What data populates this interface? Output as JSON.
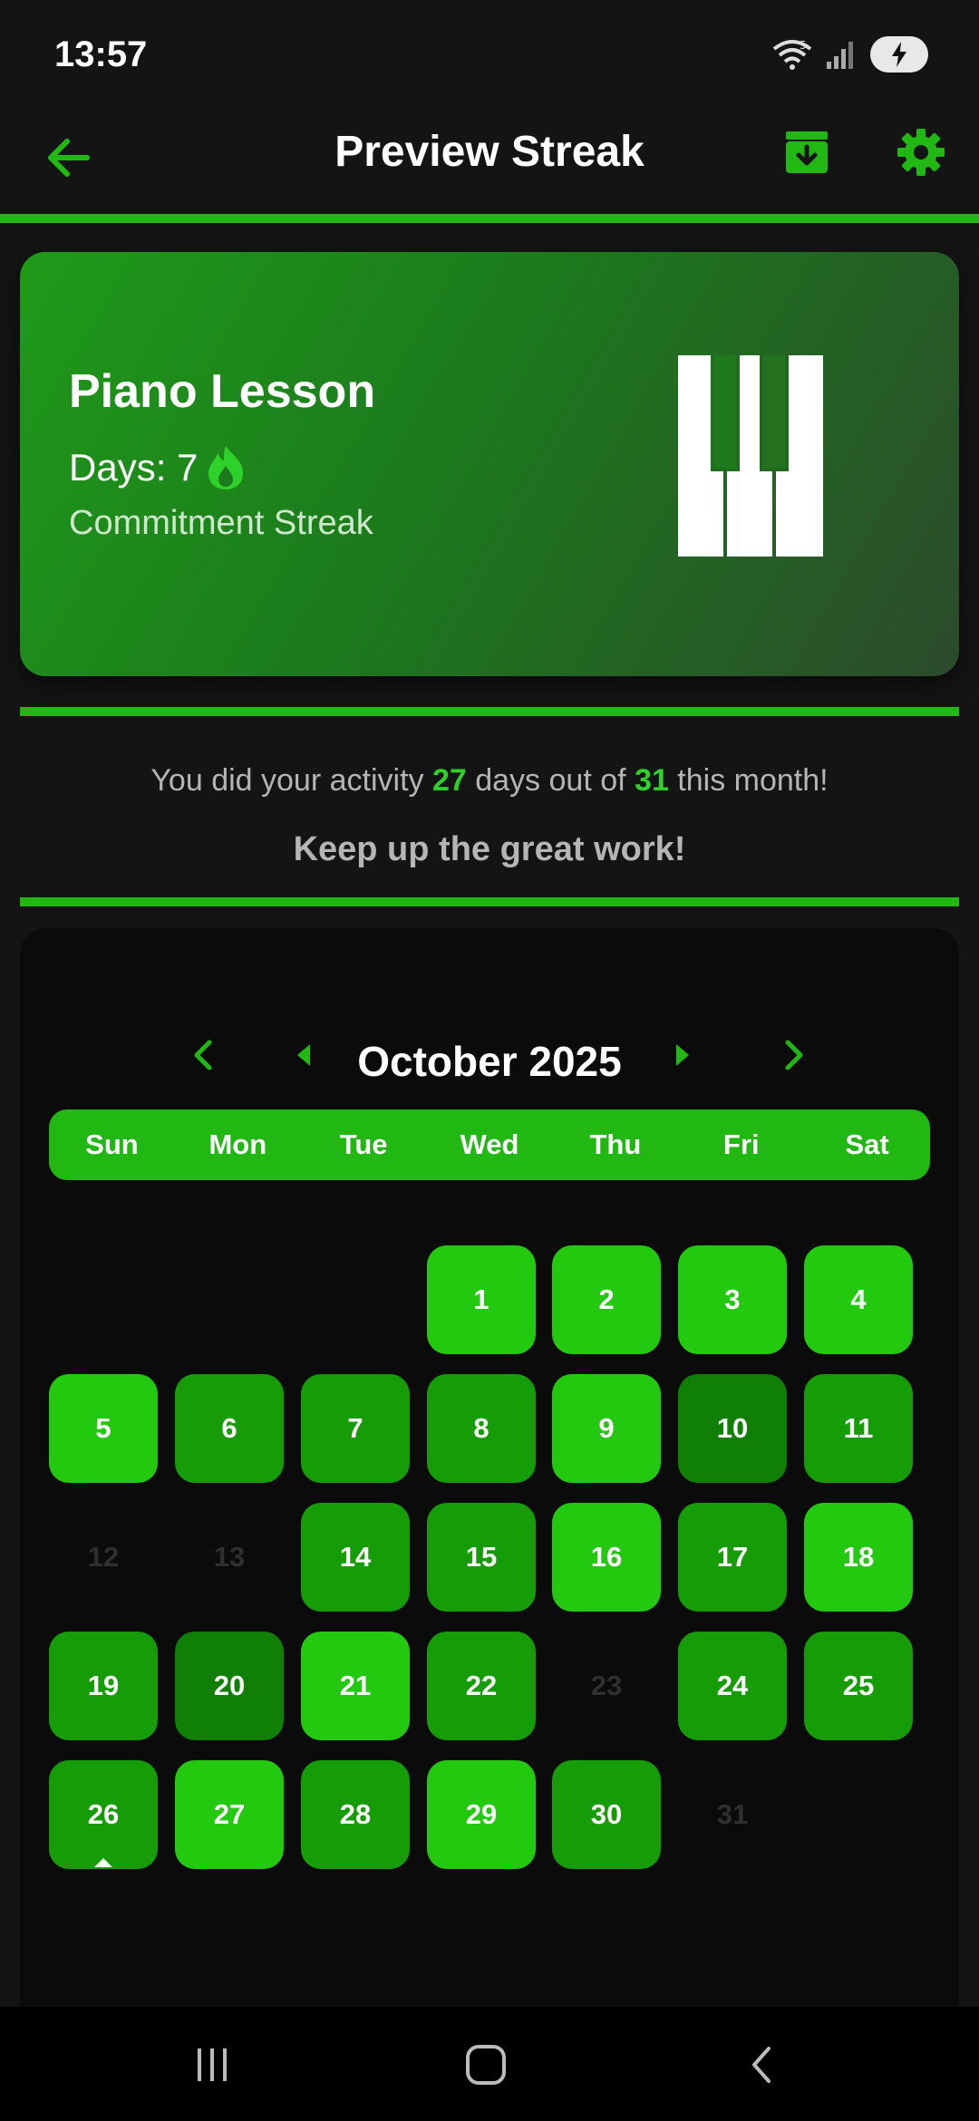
{
  "status": {
    "time": "13:57",
    "wifi_badge": "5"
  },
  "app_bar": {
    "title": "Preview Streak"
  },
  "streak_card": {
    "habit_name": "Piano Lesson",
    "days_label": "Days: 7",
    "streak_type": "Commitment Streak"
  },
  "summary": {
    "prefix": "You did your activity ",
    "done_count": "27",
    "middle": " days out of ",
    "total_count": "31",
    "suffix": " this month!",
    "encouragement": "Keep up the great work!"
  },
  "calendar": {
    "month_label": "October 2025",
    "weekdays": [
      "Sun",
      "Mon",
      "Tue",
      "Wed",
      "Thu",
      "Fri",
      "Sat"
    ],
    "first_weekday_index": 3,
    "today": 26,
    "days": [
      {
        "day": "1",
        "done": true,
        "shade": "light"
      },
      {
        "day": "2",
        "done": true,
        "shade": "light"
      },
      {
        "day": "3",
        "done": true,
        "shade": "light"
      },
      {
        "day": "4",
        "done": true,
        "shade": "light"
      },
      {
        "day": "5",
        "done": true,
        "shade": "light"
      },
      {
        "day": "6",
        "done": true,
        "shade": "medium"
      },
      {
        "day": "7",
        "done": true,
        "shade": "medium"
      },
      {
        "day": "8",
        "done": true,
        "shade": "medium"
      },
      {
        "day": "9",
        "done": true,
        "shade": "light"
      },
      {
        "day": "10",
        "done": true,
        "shade": "dark"
      },
      {
        "day": "11",
        "done": true,
        "shade": "medium"
      },
      {
        "day": "12",
        "done": false,
        "shade": "none"
      },
      {
        "day": "13",
        "done": false,
        "shade": "none"
      },
      {
        "day": "14",
        "done": true,
        "shade": "medium"
      },
      {
        "day": "15",
        "done": true,
        "shade": "medium"
      },
      {
        "day": "16",
        "done": true,
        "shade": "light"
      },
      {
        "day": "17",
        "done": true,
        "shade": "medium"
      },
      {
        "day": "18",
        "done": true,
        "shade": "light"
      },
      {
        "day": "19",
        "done": true,
        "shade": "medium"
      },
      {
        "day": "20",
        "done": true,
        "shade": "dark"
      },
      {
        "day": "21",
        "done": true,
        "shade": "light"
      },
      {
        "day": "22",
        "done": true,
        "shade": "medium"
      },
      {
        "day": "23",
        "done": false,
        "shade": "none"
      },
      {
        "day": "24",
        "done": true,
        "shade": "medium"
      },
      {
        "day": "25",
        "done": true,
        "shade": "medium"
      },
      {
        "day": "26",
        "done": true,
        "shade": "medium"
      },
      {
        "day": "27",
        "done": true,
        "shade": "light"
      },
      {
        "day": "28",
        "done": true,
        "shade": "medium"
      },
      {
        "day": "29",
        "done": true,
        "shade": "light"
      },
      {
        "day": "30",
        "done": true,
        "shade": "medium"
      },
      {
        "day": "31",
        "done": false,
        "shade": "none"
      }
    ]
  },
  "colors": {
    "accent": "#22b814",
    "day_light": "#22c90f",
    "day_medium": "#169c07",
    "day_dark": "#0f7f05"
  },
  "icons": {
    "back": "arrow-left-icon",
    "archive": "archive-download-icon",
    "settings": "gear-icon",
    "flame": "flame-icon",
    "piano": "piano-keys-icon",
    "prev_year": "chevron-left-icon",
    "prev_month": "triangle-left-icon",
    "next_month": "triangle-right-icon",
    "next_year": "chevron-right-icon"
  }
}
